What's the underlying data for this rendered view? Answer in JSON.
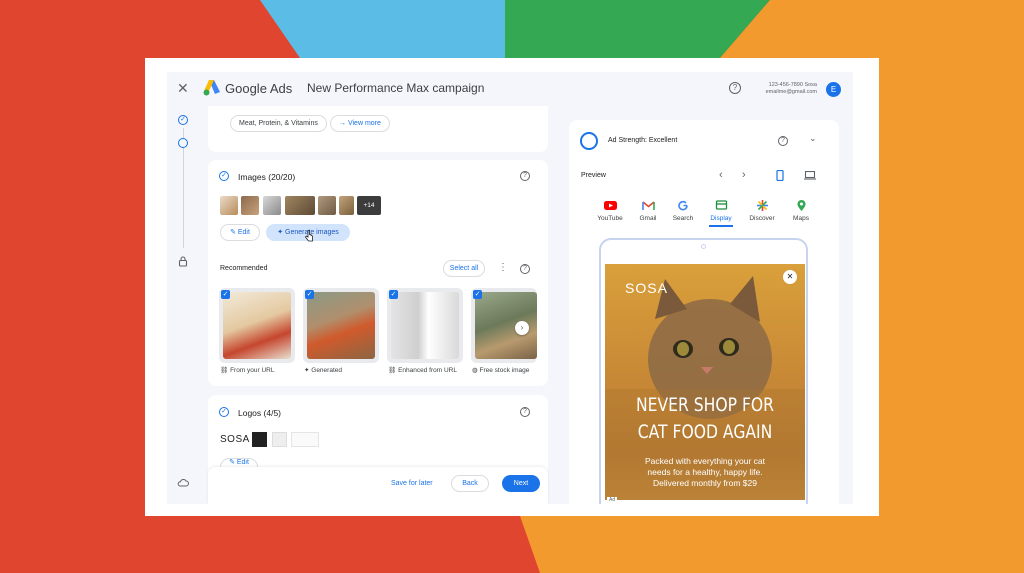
{
  "topbar": {
    "close_glyph": "✕",
    "brand": "Google Ads",
    "campaign_title": "New Performance Max campaign",
    "help_icon": "?",
    "account_phone": "123-456-7890 Sosa",
    "account_email": "emailme@gmail.com",
    "avatar_letter": "E"
  },
  "chips": {
    "meat": "Meat, Protein, & Vitamins",
    "view_more": "View more"
  },
  "images": {
    "title": "Images (20/20)",
    "more_count": "+14",
    "edit": "Edit",
    "generate": "Generate images",
    "recommended": "Recommended",
    "select_all": "Select all",
    "items": [
      {
        "label": "From your URL",
        "icon": "link-icon"
      },
      {
        "label": "Generated",
        "icon": "sparkle-icon"
      },
      {
        "label": "Enhanced from URL",
        "icon": "enhance-icon"
      },
      {
        "label": "Free stock image",
        "icon": "globe-icon"
      }
    ]
  },
  "logos": {
    "title": "Logos (4/5)",
    "sosa": "SOSA",
    "edit": "Edit"
  },
  "footer": {
    "save_later": "Save for later",
    "back": "Back",
    "next": "Next"
  },
  "preview_panel": {
    "ad_strength": "Ad Strength: Excellent",
    "preview": "Preview",
    "tabs": [
      "YouTube",
      "Gmail",
      "Search",
      "Display",
      "Discover",
      "Maps"
    ],
    "active_tab": "Display"
  },
  "ad": {
    "brand": "SOSA",
    "headline_1": "NEVER SHOP FOR",
    "headline_2": "CAT FOOD AGAIN",
    "body_1": "Packed with everything your cat",
    "body_2": "needs for a healthy, happy life.",
    "body_3": "Delivered monthly from $29",
    "close": "✕",
    "ad_badge": "Ad"
  },
  "colors": {
    "accent": "#1a73e8",
    "bg_red": "#e0452f",
    "bg_blue": "#5bbde6",
    "bg_green": "#34a853",
    "bg_orange": "#f29a2e"
  }
}
